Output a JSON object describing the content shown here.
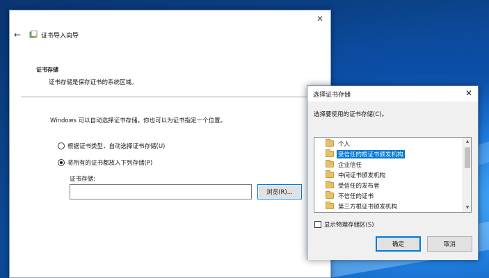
{
  "wizard": {
    "title": "证书导入向导",
    "section_heading": "证书存储",
    "section_desc": "证书存储是保存证书的系统区域。",
    "intro": "Windows 可以自动选择证书存储，你也可以为证书指定一个位置。",
    "radio_auto": "根据证书类型，自动选择证书存储(U)",
    "radio_manual": "将所有的证书都放入下列存储(P)",
    "store_label": "证书存储:",
    "store_value": "",
    "browse_label": "浏览(R)..."
  },
  "dialog": {
    "title": "选择证书存储",
    "prompt": "选择要使用的证书存储(C)。",
    "stores": [
      {
        "label": "个人",
        "selected": false
      },
      {
        "label": "受信任的根证书颁发机构",
        "selected": true
      },
      {
        "label": "企业信任",
        "selected": false
      },
      {
        "label": "中间证书颁发机构",
        "selected": false
      },
      {
        "label": "受信任的发布者",
        "selected": false
      },
      {
        "label": "不信任的证书",
        "selected": false
      },
      {
        "label": "第三方根证书颁发机构",
        "selected": false
      }
    ],
    "show_physical_label": "显示物理存储区(S)",
    "ok_label": "确定",
    "cancel_label": "取消"
  },
  "icons": {
    "close": "close-icon",
    "back": "back-arrow-icon",
    "wizard": "certificate-icon",
    "folder": "folder-icon"
  },
  "colors": {
    "accent": "#0078d7",
    "folder": "#e8c06a"
  }
}
